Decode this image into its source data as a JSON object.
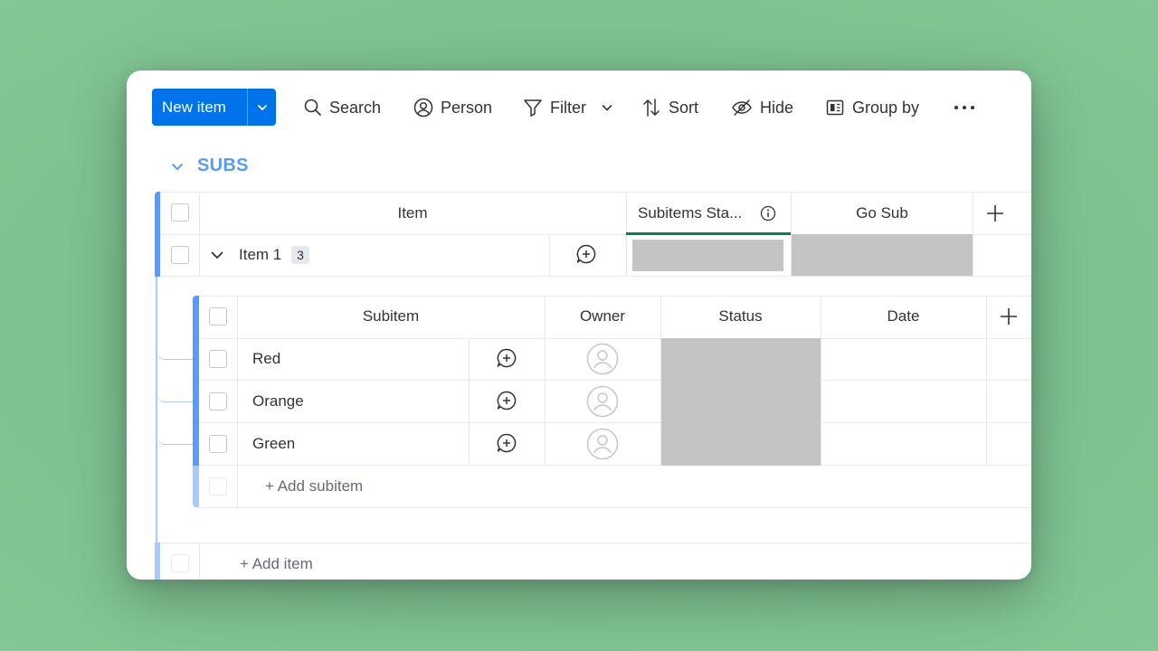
{
  "toolbar": {
    "new_item": "New item",
    "search": "Search",
    "person": "Person",
    "filter": "Filter",
    "sort": "Sort",
    "hide": "Hide",
    "group_by": "Group by"
  },
  "group": {
    "title": "SUBS",
    "color": "#579bfc"
  },
  "table": {
    "columns": {
      "item": "Item",
      "subitems_status": "Subitems Sta...",
      "go_sub": "Go Sub"
    },
    "row": {
      "name": "Item 1",
      "subitem_count": "3"
    },
    "add_item": "+ Add item"
  },
  "subtable": {
    "columns": {
      "subitem": "Subitem",
      "owner": "Owner",
      "status": "Status",
      "date": "Date"
    },
    "rows": [
      {
        "name": "Red"
      },
      {
        "name": "Orange"
      },
      {
        "name": "Green"
      }
    ],
    "add_subitem": "+ Add subitem"
  },
  "colors": {
    "primary": "#0073ea",
    "accent_blue": "#579bfc",
    "status_placeholder": "#c4c4c4",
    "active_column_underline": "#00854d"
  }
}
